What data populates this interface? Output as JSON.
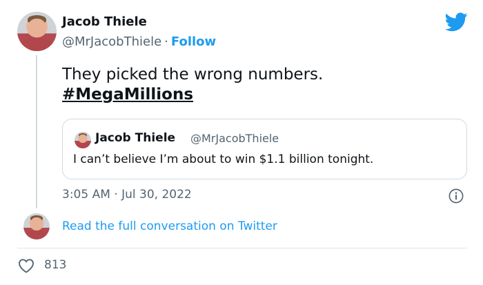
{
  "tweet": {
    "author_name": "Jacob Thiele",
    "author_handle": "@MrJacobThiele",
    "separator": "·",
    "follow_label": "Follow",
    "text": "They picked the wrong numbers.",
    "hashtag": "#MegaMillions",
    "timestamp": "3:05 AM · Jul 30, 2022",
    "like_count": "813"
  },
  "quoted_tweet": {
    "author_name": "Jacob Thiele",
    "author_handle": "@MrJacobThiele",
    "text": "I can’t believe I’m about to win $1.1 billion tonight."
  },
  "footer": {
    "read_conversation_label": "Read the full conversation on Twitter"
  },
  "icons": {
    "brand": "twitter-bird-icon",
    "info": "info-icon",
    "like": "heart-icon"
  },
  "colors": {
    "accent": "#1d9bf0",
    "text_primary": "#0f1419",
    "text_secondary": "#536471",
    "border": "#cfd9de"
  }
}
